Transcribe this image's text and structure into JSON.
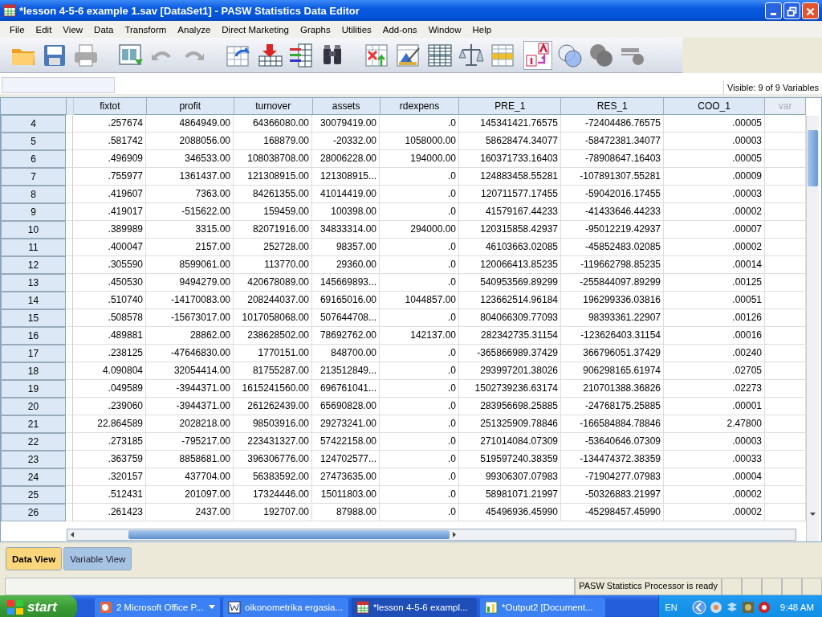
{
  "window": {
    "title": "*lesson 4-5-6 example 1.sav [DataSet1] - PASW Statistics Data Editor"
  },
  "menu": [
    "File",
    "Edit",
    "View",
    "Data",
    "Transform",
    "Analyze",
    "Direct Marketing",
    "Graphs",
    "Utilities",
    "Add-ons",
    "Window",
    "Help"
  ],
  "visible_info": "Visible: 9 of 9 Variables",
  "table": {
    "columns": [
      {
        "name": "fixtot",
        "kind": "variable"
      },
      {
        "name": "profit",
        "kind": "variable"
      },
      {
        "name": "turnover",
        "kind": "variable"
      },
      {
        "name": "assets",
        "kind": "variable"
      },
      {
        "name": "rdexpens",
        "kind": "variable"
      },
      {
        "name": "PRE_1",
        "kind": "variable"
      },
      {
        "name": "RES_1",
        "kind": "variable"
      },
      {
        "name": "COO_1",
        "kind": "variable"
      },
      {
        "name": "var",
        "kind": "empty"
      }
    ],
    "rows": [
      {
        "number": "4",
        "cells": [
          ".257674",
          "4864949.00",
          "64366080.00",
          "30079419.00",
          ".0",
          "145341421.76575",
          "-72404486.76575",
          ".00005"
        ]
      },
      {
        "number": "5",
        "cells": [
          ".581742",
          "2088056.00",
          "168879.00",
          "-20332.00",
          "1058000.00",
          "58628474.34077",
          "-58472381.34077",
          ".00003"
        ]
      },
      {
        "number": "6",
        "cells": [
          ".496909",
          "346533.00",
          "108038708.00",
          "28006228.00",
          "194000.00",
          "160371733.16403",
          "-78908647.16403",
          ".00005"
        ]
      },
      {
        "number": "7",
        "cells": [
          ".755977",
          "1361437.00",
          "121308915.00",
          "121308915...",
          ".0",
          "124883458.55281",
          "-107891307.55281",
          ".00009"
        ]
      },
      {
        "number": "8",
        "cells": [
          ".419607",
          "7363.00",
          "84261355.00",
          "41014419.00",
          ".0",
          "120711577.17455",
          "-59042016.17455",
          ".00003"
        ]
      },
      {
        "number": "9",
        "cells": [
          ".419017",
          "-515622.00",
          "159459.00",
          "100398.00",
          ".0",
          "41579167.44233",
          "-41433646.44233",
          ".00002"
        ]
      },
      {
        "number": "10",
        "cells": [
          ".389989",
          "3315.00",
          "82071916.00",
          "34833314.00",
          "294000.00",
          "120315858.42937",
          "-95012219.42937",
          ".00007"
        ]
      },
      {
        "number": "11",
        "cells": [
          ".400047",
          "2157.00",
          "252728.00",
          "98357.00",
          ".0",
          "46103663.02085",
          "-45852483.02085",
          ".00002"
        ]
      },
      {
        "number": "12",
        "cells": [
          ".305590",
          "8599061.00",
          "113770.00",
          "29360.00",
          ".0",
          "120066413.85235",
          "-119662798.85235",
          ".00014"
        ]
      },
      {
        "number": "13",
        "cells": [
          ".450530",
          "9494279.00",
          "420678089.00",
          "145669893...",
          ".0",
          "540953569.89299",
          "-255844097.89299",
          ".00125"
        ]
      },
      {
        "number": "14",
        "cells": [
          ".510740",
          "-14170083.00",
          "208244037.00",
          "69165016.00",
          "1044857.00",
          "123662514.96184",
          "196299336.03816",
          ".00051"
        ]
      },
      {
        "number": "15",
        "cells": [
          ".508578",
          "-15673017.00",
          "1017058068.00",
          "507644708...",
          ".0",
          "804066309.77093",
          "98393361.22907",
          ".00126"
        ]
      },
      {
        "number": "16",
        "cells": [
          ".489881",
          "28862.00",
          "238628502.00",
          "78692762.00",
          "142137.00",
          "282342735.31154",
          "-123626403.31154",
          ".00016"
        ]
      },
      {
        "number": "17",
        "cells": [
          ".238125",
          "-47646830.00",
          "1770151.00",
          "848700.00",
          ".0",
          "-365866989.37429",
          "366796051.37429",
          ".00240"
        ]
      },
      {
        "number": "18",
        "cells": [
          "4.090804",
          "32054414.00",
          "81755287.00",
          "213512849...",
          ".0",
          "293997201.38026",
          "906298165.61974",
          ".02705"
        ]
      },
      {
        "number": "19",
        "cells": [
          ".049589",
          "-3944371.00",
          "1615241560.00",
          "696761041...",
          ".0",
          "1502739236.63174",
          "210701388.36826",
          ".02273"
        ]
      },
      {
        "number": "20",
        "cells": [
          ".239060",
          "-3944371.00",
          "261262439.00",
          "65690828.00",
          ".0",
          "283956698.25885",
          "-24768175.25885",
          ".00001"
        ]
      },
      {
        "number": "21",
        "cells": [
          "22.864589",
          "2028218.00",
          "98503916.00",
          "29273241.00",
          ".0",
          "251325909.78846",
          "-166584884.78846",
          "2.47800"
        ]
      },
      {
        "number": "22",
        "cells": [
          ".273185",
          "-795217.00",
          "223431327.00",
          "57422158.00",
          ".0",
          "271014084.07309",
          "-53640646.07309",
          ".00003"
        ]
      },
      {
        "number": "23",
        "cells": [
          ".363759",
          "8858681.00",
          "396306776.00",
          "124702577...",
          ".0",
          "519597240.38359",
          "-134474372.38359",
          ".00033"
        ]
      },
      {
        "number": "24",
        "cells": [
          ".320157",
          "437704.00",
          "56383592.00",
          "27473635.00",
          ".0",
          "99306307.07983",
          "-71904277.07983",
          ".00004"
        ]
      },
      {
        "number": "25",
        "cells": [
          ".512431",
          "201097.00",
          "17324446.00",
          "15011803.00",
          ".0",
          "58981071.21997",
          "-50326883.21997",
          ".00002"
        ]
      },
      {
        "number": "26",
        "cells": [
          ".261423",
          "2437.00",
          "192707.00",
          "87988.00",
          ".0",
          "45496936.45990",
          "-45298457.45990",
          ".00002"
        ]
      }
    ]
  },
  "view_tabs": [
    {
      "label": "Data View",
      "selected": true
    },
    {
      "label": "Variable View",
      "selected": false
    }
  ],
  "status_bar": "PASW Statistics Processor is ready",
  "taskbar": {
    "start": "start",
    "items": [
      {
        "label": "2 Microsoft Office P...",
        "kind": "powerpoint",
        "selected": false,
        "dropdown": true
      },
      {
        "label": "oikonometrika ergasia...",
        "kind": "word",
        "selected": false,
        "dropdown": false
      },
      {
        "label": "*lesson 4-5-6 exampl...",
        "kind": "spss",
        "selected": true,
        "dropdown": false
      },
      {
        "label": "*Output2 [Document...",
        "kind": "output",
        "selected": false,
        "dropdown": false
      }
    ],
    "language": "EN",
    "clock": "9:48 AM"
  }
}
